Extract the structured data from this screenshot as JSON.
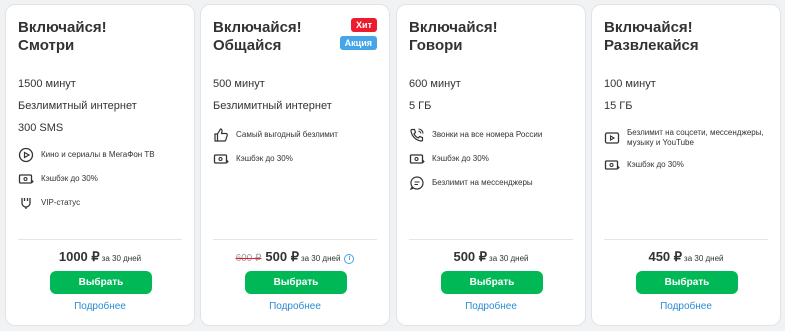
{
  "cards": [
    {
      "title1": "Включайся!",
      "title2": "Смотри",
      "features": [
        "1500 минут",
        "Безлимитный интернет",
        "300 SMS"
      ],
      "perks": [
        {
          "icon": "play-icon",
          "text": "Кино и сериалы в МегаФон ТВ"
        },
        {
          "icon": "cashback-icon",
          "text": "Кэшбэк до 30%"
        },
        {
          "icon": "vip-icon",
          "text": "VIP-статус"
        }
      ],
      "price": "1000 ₽",
      "per": "за 30 дней",
      "button": "Выбрать",
      "more": "Подробнее"
    },
    {
      "title1": "Включайся!",
      "title2": "Общайся",
      "badges": [
        {
          "text": "Хит",
          "color": "#eb1c2d"
        },
        {
          "text": "Акция",
          "color": "#44a5e9"
        }
      ],
      "features": [
        "500 минут",
        "Безлимитный интернет"
      ],
      "perks": [
        {
          "icon": "thumbs-up-icon",
          "text": "Самый выгодный безлимит"
        },
        {
          "icon": "cashback-icon",
          "text": "Кэшбэк до 30%"
        }
      ],
      "old_price": "600 ₽",
      "price": "500 ₽",
      "per": "за 30 дней",
      "button": "Выбрать",
      "more": "Подробнее"
    },
    {
      "title1": "Включайся!",
      "title2": "Говори",
      "features": [
        "600 минут",
        "5 ГБ"
      ],
      "perks": [
        {
          "icon": "phone-icon",
          "text": "Звонки на все номера России"
        },
        {
          "icon": "cashback-icon",
          "text": "Кэшбэк до 30%"
        },
        {
          "icon": "chat-icon",
          "text": "Безлимит на мессенджеры"
        }
      ],
      "price": "500 ₽",
      "per": "за 30 дней",
      "button": "Выбрать",
      "more": "Подробнее"
    },
    {
      "title1": "Включайся!",
      "title2": "Развлекайся",
      "features": [
        "100 минут",
        "15 ГБ"
      ],
      "perks": [
        {
          "icon": "video-icon",
          "text": "Безлимит на соцсети, мессенджеры, музыку и YouTube"
        },
        {
          "icon": "cashback-icon",
          "text": "Кэшбэк до 30%"
        }
      ],
      "price": "450 ₽",
      "per": "за 30 дней",
      "button": "Выбрать",
      "more": "Подробнее"
    }
  ],
  "colors": {
    "accent": "#00b956",
    "link": "#2a8bd3",
    "hit": "#eb1c2d",
    "promo": "#44a5e9"
  }
}
